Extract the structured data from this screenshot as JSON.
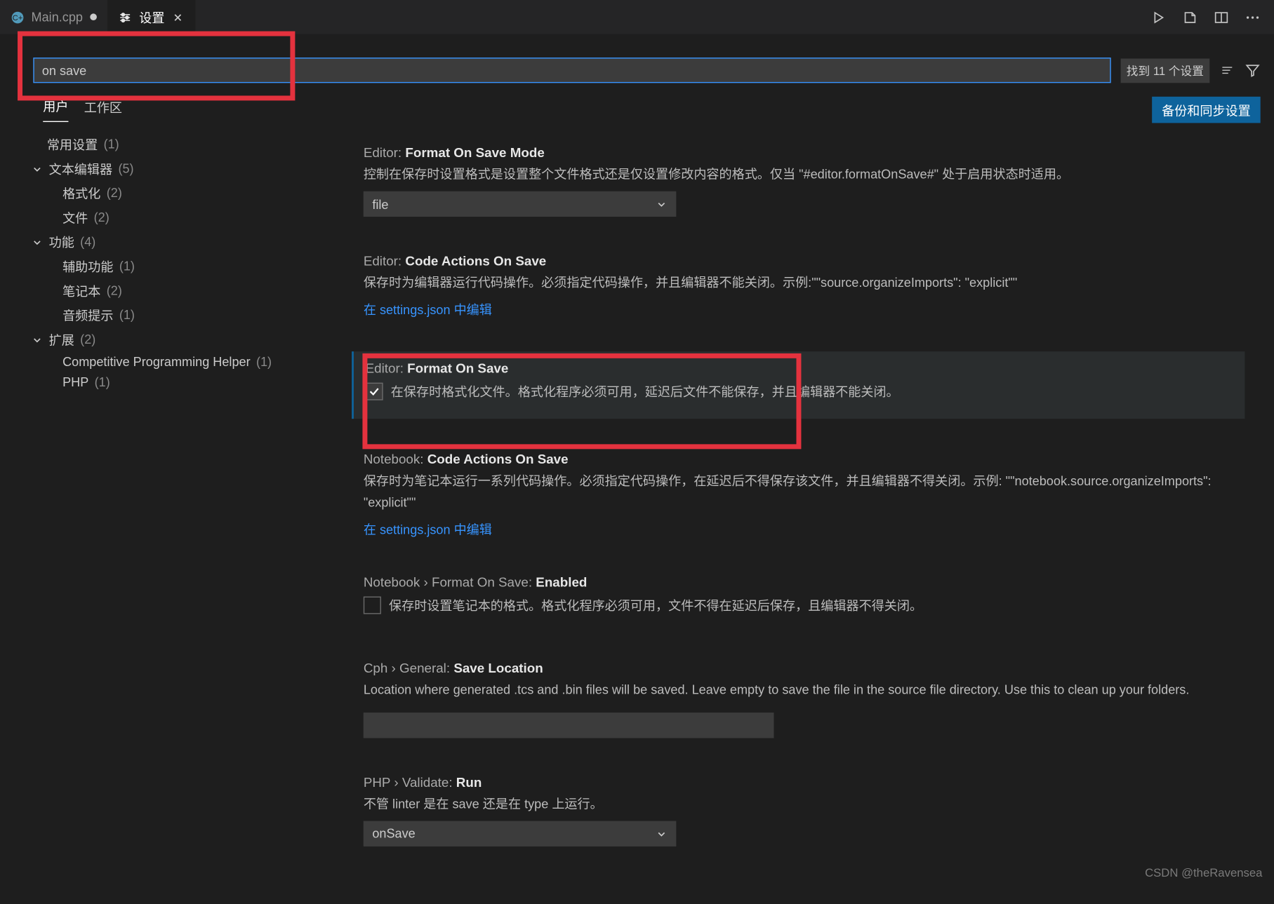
{
  "tabs": [
    {
      "label": "Main.cpp",
      "modified": true
    },
    {
      "label": "设置"
    }
  ],
  "search": {
    "value": "on save",
    "results": "找到 11 个设置"
  },
  "scopes": {
    "user": "用户",
    "workspace": "工作区"
  },
  "sync_button": "备份和同步设置",
  "tree": {
    "common": {
      "label": "常用设置",
      "count": "(1)"
    },
    "text_editor": {
      "label": "文本编辑器",
      "count": "(5)",
      "formatting": {
        "label": "格式化",
        "count": "(2)"
      },
      "files": {
        "label": "文件",
        "count": "(2)"
      }
    },
    "features": {
      "label": "功能",
      "count": "(4)",
      "accessibility": {
        "label": "辅助功能",
        "count": "(1)"
      },
      "notebook": {
        "label": "笔记本",
        "count": "(2)"
      },
      "audio": {
        "label": "音频提示",
        "count": "(1)"
      }
    },
    "extensions": {
      "label": "扩展",
      "count": "(2)",
      "cph": {
        "label": "Competitive Programming Helper",
        "count": "(1)"
      },
      "php": {
        "label": "PHP",
        "count": "(1)"
      }
    }
  },
  "link_text": "在 settings.json 中编辑",
  "settings": {
    "s1": {
      "prefix": "Editor:",
      "name": "Format On Save Mode",
      "desc": "控制在保存时设置格式是设置整个文件格式还是仅设置修改内容的格式。仅当 \"#editor.formatOnSave#\" 处于启用状态时适用。",
      "value": "file"
    },
    "s2": {
      "prefix": "Editor:",
      "name": "Code Actions On Save",
      "desc": "保存时为编辑器运行代码操作。必须指定代码操作，并且编辑器不能关闭。示例:\"\"source.organizeImports\": \"explicit\"\""
    },
    "s3": {
      "prefix": "Editor:",
      "name": "Format On Save",
      "desc": "在保存时格式化文件。格式化程序必须可用，延迟后文件不能保存，并且编辑器不能关闭。"
    },
    "s4": {
      "prefix": "Notebook:",
      "name": "Code Actions On Save",
      "desc": "保存时为笔记本运行一系列代码操作。必须指定代码操作，在延迟后不得保存该文件，并且编辑器不得关闭。示例: \"\"notebook.source.organizeImports\": \"explicit\"\""
    },
    "s5": {
      "prefix": "Notebook › Format On Save:",
      "name": "Enabled",
      "desc": "保存时设置笔记本的格式。格式化程序必须可用，文件不得在延迟后保存，且编辑器不得关闭。"
    },
    "s6": {
      "prefix": "Cph › General:",
      "name": "Save Location",
      "desc": "Location where generated .tcs and .bin files will be saved. Leave empty to save the file in the source file directory. Use this to clean up your folders."
    },
    "s7": {
      "prefix": "PHP › Validate:",
      "name": "Run",
      "desc": "不管 linter 是在 save 还是在 type 上运行。",
      "value": "onSave"
    }
  },
  "watermark": "CSDN @theRavensea"
}
